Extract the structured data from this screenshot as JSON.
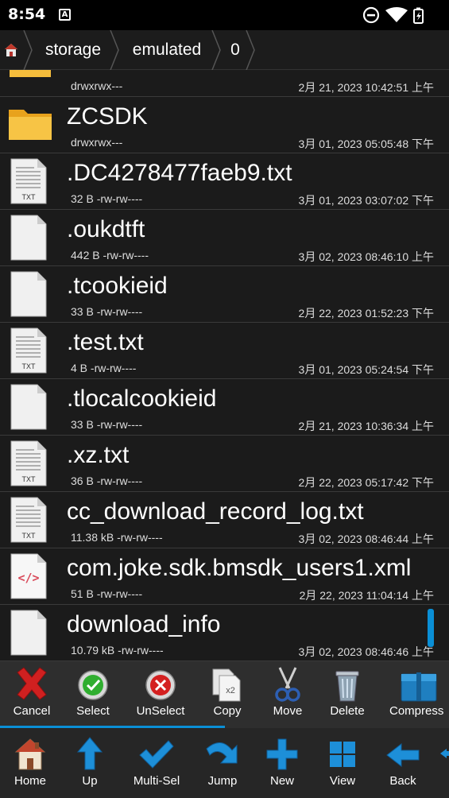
{
  "status_bar": {
    "time": "8:54",
    "notification_icon": "a-icon",
    "icons": [
      "dnd-icon",
      "wifi-icon",
      "battery-icon"
    ]
  },
  "breadcrumb": {
    "home_icon": "home-icon",
    "segments": [
      "storage",
      "emulated",
      "0"
    ]
  },
  "files": [
    {
      "name": "",
      "meta": "drwxrwx---",
      "date": "2月 21, 2023 10:42:51 上午",
      "icon": "folder-icon"
    },
    {
      "name": "ZCSDK",
      "meta": "drwxrwx---",
      "date": "3月 01, 2023 05:05:48 下午",
      "icon": "folder-icon"
    },
    {
      "name": ".DC4278477faeb9.txt",
      "meta": "32 B -rw-rw----",
      "date": "3月 01, 2023 03:07:02 下午",
      "icon": "txt-file-icon",
      "badge": "TXT"
    },
    {
      "name": ".oukdtft",
      "meta": "442 B -rw-rw----",
      "date": "3月 02, 2023 08:46:10 上午",
      "icon": "blank-file-icon"
    },
    {
      "name": ".tcookieid",
      "meta": "33 B -rw-rw----",
      "date": "2月 22, 2023 01:52:23 下午",
      "icon": "blank-file-icon"
    },
    {
      "name": ".test.txt",
      "meta": "4 B -rw-rw----",
      "date": "3月 01, 2023 05:24:54 下午",
      "icon": "txt-file-icon",
      "badge": "TXT"
    },
    {
      "name": ".tlocalcookieid",
      "meta": "33 B -rw-rw----",
      "date": "2月 21, 2023 10:36:34 上午",
      "icon": "blank-file-icon"
    },
    {
      "name": ".xz.txt",
      "meta": "36 B -rw-rw----",
      "date": "2月 22, 2023 05:17:42 下午",
      "icon": "txt-file-icon",
      "badge": "TXT"
    },
    {
      "name": "cc_download_record_log.txt",
      "meta": "11.38 kB -rw-rw----",
      "date": "3月 02, 2023 08:46:44 上午",
      "icon": "txt-file-icon",
      "badge": "TXT"
    },
    {
      "name": "com.joke.sdk.bmsdk_users1.xml",
      "meta": "51 B -rw-rw----",
      "date": "2月 22, 2023 11:04:14 上午",
      "icon": "xml-file-icon",
      "badge": "</>"
    },
    {
      "name": "download_info",
      "meta": "10.79 kB -rw-rw----",
      "date": "3月 02, 2023 08:46:46 上午",
      "icon": "blank-file-icon"
    }
  ],
  "action_bar": {
    "cancel": "Cancel",
    "select": "Select",
    "unselect": "UnSelect",
    "copy": "Copy",
    "copy_badge": "x2",
    "move": "Move",
    "delete": "Delete",
    "compress": "Compress"
  },
  "nav_bar": {
    "home": "Home",
    "up": "Up",
    "multisel": "Multi-Sel",
    "jump": "Jump",
    "new": "New",
    "view": "View",
    "back": "Back"
  },
  "colors": {
    "accent": "#0a8fd6",
    "folder": "#f2b632",
    "cancel_red": "#d02020",
    "select_green": "#2fae2f"
  }
}
